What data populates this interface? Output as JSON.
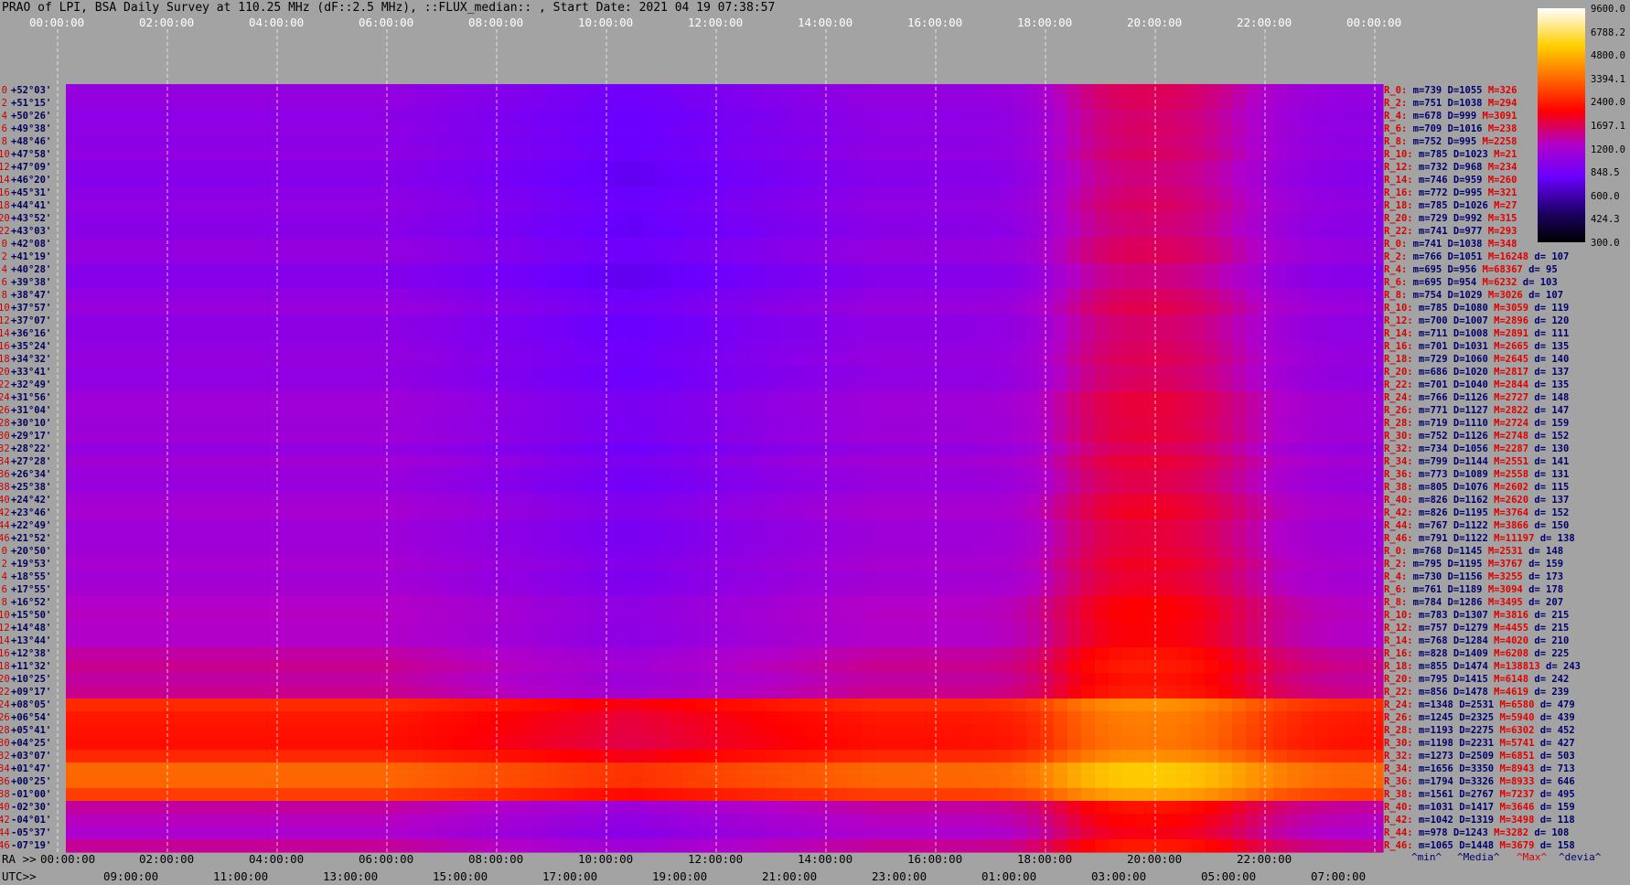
{
  "title": "PRAO of LPI, BSA Daily Survey at 110.25 MHz (dF::2.5 MHz), ::FLUX_median:: , Start Date: 2021 04 19 07:38:57",
  "top_ticks": [
    "00:00:00",
    "02:00:00",
    "04:00:00",
    "06:00:00",
    "08:00:00",
    "10:00:00",
    "12:00:00",
    "14:00:00",
    "16:00:00",
    "18:00:00",
    "20:00:00",
    "22:00:00",
    "00:00:00"
  ],
  "bottom_ra_label": "RA >>",
  "bottom_ra_ticks": [
    "00:00:00",
    "02:00:00",
    "04:00:00",
    "06:00:00",
    "08:00:00",
    "10:00:00",
    "12:00:00",
    "14:00:00",
    "16:00:00",
    "18:00:00",
    "20:00:00",
    "22:00:00"
  ],
  "bottom_utc_label": "UTC>>",
  "bottom_utc_ticks": [
    "09:00:00",
    "11:00:00",
    "13:00:00",
    "15:00:00",
    "17:00:00",
    "19:00:00",
    "21:00:00",
    "23:00:00",
    "01:00:00",
    "03:00:00",
    "05:00:00",
    "07:00:00"
  ],
  "stat_legend": [
    "^min^",
    "^Media^",
    "^Max^",
    "^devia^"
  ],
  "colorbar_labels": [
    "9600.0",
    "6788.2",
    "4800.0",
    "3394.1",
    "2400.0",
    "1697.1",
    "1200.0",
    "848.5",
    "600.0",
    "424.3",
    "300.0"
  ],
  "colors": {
    "bg": "#a3a3a3",
    "low": "#6600ff",
    "mid": "#ff0000",
    "high": "#ffff99"
  },
  "chart_data": {
    "type": "heatmap",
    "title": "PRAO of LPI, BSA Daily Survey at 110.25 MHz (dF::2.5 MHz), ::FLUX_median:: , Start Date: 2021 04 19 07:38:57",
    "xlabel": "RA / UTC",
    "x_range": [
      "00:00:00",
      "24:00:00"
    ],
    "color_scale": "log",
    "clim": [
      300,
      9600
    ],
    "rows": [
      {
        "idx": "0",
        "dec": "+52°03'",
        "label": "R_0:",
        "min": "739",
        "med": "1055",
        "max": "326",
        "dev": ""
      },
      {
        "idx": "2",
        "dec": "+51°15'",
        "label": "R_2:",
        "min": "751",
        "med": "1038",
        "max": "294",
        "dev": ""
      },
      {
        "idx": "4",
        "dec": "+50°26'",
        "label": "R_4:",
        "min": "678",
        "med": "999",
        "max": "3091",
        "dev": ""
      },
      {
        "idx": "6",
        "dec": "+49°38'",
        "label": "R_6:",
        "min": "709",
        "med": "1016",
        "max": "238",
        "dev": ""
      },
      {
        "idx": "8",
        "dec": "+48°46'",
        "label": "R_8:",
        "min": "752",
        "med": "995",
        "max": "2258",
        "dev": ""
      },
      {
        "idx": "10",
        "dec": "+47°58'",
        "label": "R_10:",
        "min": "785",
        "med": "1023",
        "max": "21",
        "dev": ""
      },
      {
        "idx": "12",
        "dec": "+47°09'",
        "label": "R_12:",
        "min": "732",
        "med": "968",
        "max": "234",
        "dev": ""
      },
      {
        "idx": "14",
        "dec": "+46°20'",
        "label": "R_14:",
        "min": "746",
        "med": "959",
        "max": "260",
        "dev": ""
      },
      {
        "idx": "16",
        "dec": "+45°31'",
        "label": "R_16:",
        "min": "772",
        "med": "995",
        "max": "321",
        "dev": ""
      },
      {
        "idx": "18",
        "dec": "+44°41'",
        "label": "R_18:",
        "min": "785",
        "med": "1026",
        "max": "27",
        "dev": ""
      },
      {
        "idx": "20",
        "dec": "+43°52'",
        "label": "R_20:",
        "min": "729",
        "med": "992",
        "max": "315",
        "dev": ""
      },
      {
        "idx": "22",
        "dec": "+43°03'",
        "label": "R_22:",
        "min": "741",
        "med": "977",
        "max": "293",
        "dev": ""
      },
      {
        "idx": "0",
        "dec": "+42°08'",
        "label": "R_0:",
        "min": "741",
        "med": "1038",
        "max": "348",
        "dev": ""
      },
      {
        "idx": "2",
        "dec": "+41°19'",
        "label": "R_2:",
        "min": "766",
        "med": "1051",
        "max": "16248",
        "dev": "107"
      },
      {
        "idx": "4",
        "dec": "+40°28'",
        "label": "R_4:",
        "min": "695",
        "med": "956",
        "max": "68367",
        "dev": "95"
      },
      {
        "idx": "6",
        "dec": "+39°38'",
        "label": "R_6:",
        "min": "695",
        "med": "954",
        "max": "6232",
        "dev": "103"
      },
      {
        "idx": "8",
        "dec": "+38°47'",
        "label": "R_8:",
        "min": "754",
        "med": "1029",
        "max": "3026",
        "dev": "107"
      },
      {
        "idx": "10",
        "dec": "+37°57'",
        "label": "R_10:",
        "min": "785",
        "med": "1080",
        "max": "3059",
        "dev": "119"
      },
      {
        "idx": "12",
        "dec": "+37°07'",
        "label": "R_12:",
        "min": "700",
        "med": "1007",
        "max": "2896",
        "dev": "120"
      },
      {
        "idx": "14",
        "dec": "+36°16'",
        "label": "R_14:",
        "min": "711",
        "med": "1008",
        "max": "2891",
        "dev": "111"
      },
      {
        "idx": "16",
        "dec": "+35°24'",
        "label": "R_16:",
        "min": "701",
        "med": "1031",
        "max": "2665",
        "dev": "135"
      },
      {
        "idx": "18",
        "dec": "+34°32'",
        "label": "R_18:",
        "min": "729",
        "med": "1060",
        "max": "2645",
        "dev": "140"
      },
      {
        "idx": "20",
        "dec": "+33°41'",
        "label": "R_20:",
        "min": "686",
        "med": "1020",
        "max": "2817",
        "dev": "137"
      },
      {
        "idx": "22",
        "dec": "+32°49'",
        "label": "R_22:",
        "min": "701",
        "med": "1040",
        "max": "2844",
        "dev": "135"
      },
      {
        "idx": "24",
        "dec": "+31°56'",
        "label": "R_24:",
        "min": "766",
        "med": "1126",
        "max": "2727",
        "dev": "148"
      },
      {
        "idx": "26",
        "dec": "+31°04'",
        "label": "R_26:",
        "min": "771",
        "med": "1127",
        "max": "2822",
        "dev": "147"
      },
      {
        "idx": "28",
        "dec": "+30°10'",
        "label": "R_28:",
        "min": "719",
        "med": "1110",
        "max": "2724",
        "dev": "159"
      },
      {
        "idx": "30",
        "dec": "+29°17'",
        "label": "R_30:",
        "min": "752",
        "med": "1126",
        "max": "2748",
        "dev": "152"
      },
      {
        "idx": "32",
        "dec": "+28°22'",
        "label": "R_32:",
        "min": "734",
        "med": "1056",
        "max": "2287",
        "dev": "130"
      },
      {
        "idx": "34",
        "dec": "+27°28'",
        "label": "R_34:",
        "min": "799",
        "med": "1144",
        "max": "2551",
        "dev": "141"
      },
      {
        "idx": "36",
        "dec": "+26°34'",
        "label": "R_36:",
        "min": "773",
        "med": "1089",
        "max": "2558",
        "dev": "131"
      },
      {
        "idx": "38",
        "dec": "+25°38'",
        "label": "R_38:",
        "min": "805",
        "med": "1076",
        "max": "2602",
        "dev": "115"
      },
      {
        "idx": "40",
        "dec": "+24°42'",
        "label": "R_40:",
        "min": "826",
        "med": "1162",
        "max": "2620",
        "dev": "137"
      },
      {
        "idx": "42",
        "dec": "+23°46'",
        "label": "R_42:",
        "min": "826",
        "med": "1195",
        "max": "3764",
        "dev": "152"
      },
      {
        "idx": "44",
        "dec": "+22°49'",
        "label": "R_44:",
        "min": "767",
        "med": "1122",
        "max": "3866",
        "dev": "150"
      },
      {
        "idx": "46",
        "dec": "+21°52'",
        "label": "R_46:",
        "min": "791",
        "med": "1122",
        "max": "11197",
        "dev": "138"
      },
      {
        "idx": "0",
        "dec": "+20°50'",
        "label": "R_0:",
        "min": "768",
        "med": "1145",
        "max": "2531",
        "dev": "148"
      },
      {
        "idx": "2",
        "dec": "+19°53'",
        "label": "R_2:",
        "min": "795",
        "med": "1195",
        "max": "3767",
        "dev": "159"
      },
      {
        "idx": "4",
        "dec": "+18°55'",
        "label": "R_4:",
        "min": "730",
        "med": "1156",
        "max": "3255",
        "dev": "173"
      },
      {
        "idx": "6",
        "dec": "+17°55'",
        "label": "R_6:",
        "min": "761",
        "med": "1189",
        "max": "3094",
        "dev": "178"
      },
      {
        "idx": "8",
        "dec": "+16°52'",
        "label": "R_8:",
        "min": "784",
        "med": "1286",
        "max": "3495",
        "dev": "207"
      },
      {
        "idx": "10",
        "dec": "+15°50'",
        "label": "R_10:",
        "min": "783",
        "med": "1307",
        "max": "3816",
        "dev": "215"
      },
      {
        "idx": "12",
        "dec": "+14°48'",
        "label": "R_12:",
        "min": "757",
        "med": "1279",
        "max": "4455",
        "dev": "215"
      },
      {
        "idx": "14",
        "dec": "+13°44'",
        "label": "R_14:",
        "min": "768",
        "med": "1284",
        "max": "4020",
        "dev": "210"
      },
      {
        "idx": "16",
        "dec": "+12°38'",
        "label": "R_16:",
        "min": "828",
        "med": "1409",
        "max": "6208",
        "dev": "225"
      },
      {
        "idx": "18",
        "dec": "+11°32'",
        "label": "R_18:",
        "min": "855",
        "med": "1474",
        "max": "138813",
        "dev": "243"
      },
      {
        "idx": "20",
        "dec": "+10°25'",
        "label": "R_20:",
        "min": "795",
        "med": "1415",
        "max": "6148",
        "dev": "242"
      },
      {
        "idx": "22",
        "dec": "+09°17'",
        "label": "R_22:",
        "min": "856",
        "med": "1478",
        "max": "4619",
        "dev": "239"
      },
      {
        "idx": "24",
        "dec": "+08°05'",
        "label": "R_24:",
        "min": "1348",
        "med": "2531",
        "max": "6580",
        "dev": "479"
      },
      {
        "idx": "26",
        "dec": "+06°54'",
        "label": "R_26:",
        "min": "1245",
        "med": "2325",
        "max": "5940",
        "dev": "439"
      },
      {
        "idx": "28",
        "dec": "+05°41'",
        "label": "R_28:",
        "min": "1193",
        "med": "2275",
        "max": "6302",
        "dev": "452"
      },
      {
        "idx": "30",
        "dec": "+04°25'",
        "label": "R_30:",
        "min": "1198",
        "med": "2231",
        "max": "5741",
        "dev": "427"
      },
      {
        "idx": "32",
        "dec": "+03°07'",
        "label": "R_32:",
        "min": "1273",
        "med": "2509",
        "max": "6851",
        "dev": "503"
      },
      {
        "idx": "34",
        "dec": "+01°47'",
        "label": "R_34:",
        "min": "1656",
        "med": "3350",
        "max": "8943",
        "dev": "713"
      },
      {
        "idx": "36",
        "dec": "+00°25'",
        "label": "R_36:",
        "min": "1794",
        "med": "3326",
        "max": "8933",
        "dev": "646"
      },
      {
        "idx": "38",
        "dec": "-01°00'",
        "label": "R_38:",
        "min": "1561",
        "med": "2767",
        "max": "7237",
        "dev": "495"
      },
      {
        "idx": "40",
        "dec": "-02°30'",
        "label": "R_40:",
        "min": "1031",
        "med": "1417",
        "max": "3646",
        "dev": "159"
      },
      {
        "idx": "42",
        "dec": "-04°01'",
        "label": "R_42:",
        "min": "1042",
        "med": "1319",
        "max": "3498",
        "dev": "118"
      },
      {
        "idx": "44",
        "dec": "-05°37'",
        "label": "R_44:",
        "min": "978",
        "med": "1243",
        "max": "3282",
        "dev": "108"
      },
      {
        "idx": "46",
        "dec": "-07°19'",
        "label": "R_46:",
        "min": "1065",
        "med": "1448",
        "max": "3679",
        "dev": "158"
      }
    ]
  }
}
